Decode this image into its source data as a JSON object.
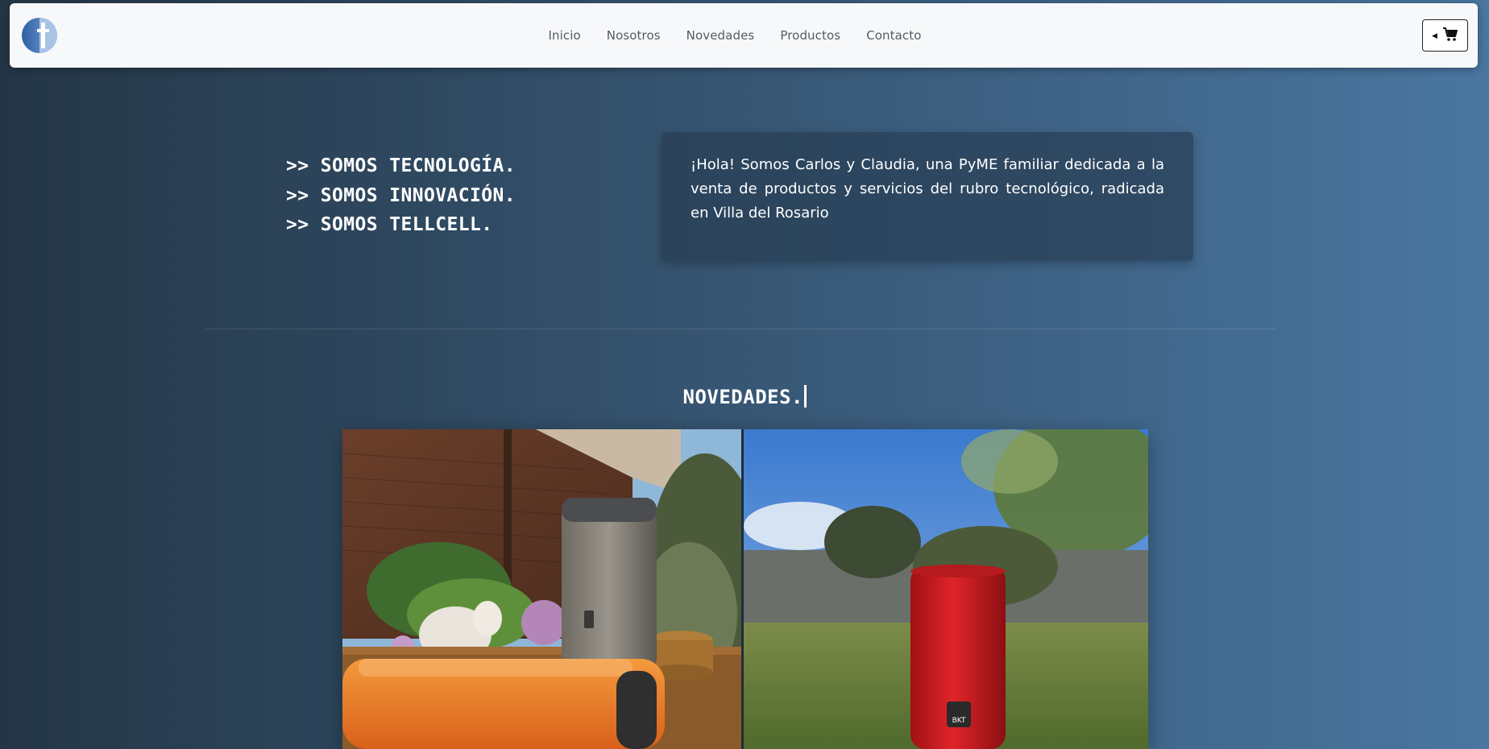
{
  "navbar": {
    "logo_icon": "tellcell-logo-icon",
    "links": [
      "Inicio",
      "Nosotros",
      "Novedades",
      "Productos",
      "Contacto"
    ],
    "cart_icon": "shopping-cart-icon",
    "cart_caret_icon": "caret-left-icon"
  },
  "hero": {
    "slogans": [
      ">> SOMOS TECNOLOGÍA.",
      ">> SOMOS INNOVACIÓN.",
      ">> SOMOS TELLCELL."
    ],
    "intro": "¡Hola! Somos Carlos y Claudia, una PyME familiar dedicada a la venta de productos y servicios del rubro tecnológico, radicada en Villa del Rosario"
  },
  "novedades": {
    "title": "NOVEDADES.",
    "photos": [
      {
        "name": "orange-and-grey-speakers-photo"
      },
      {
        "name": "red-speaker-photo",
        "badge": "BKT"
      }
    ]
  },
  "colors": {
    "navbar_bg": "#f7f8fa",
    "bg_left": "#243646",
    "bg_right": "#4a76a0",
    "text": "#ffffff"
  }
}
